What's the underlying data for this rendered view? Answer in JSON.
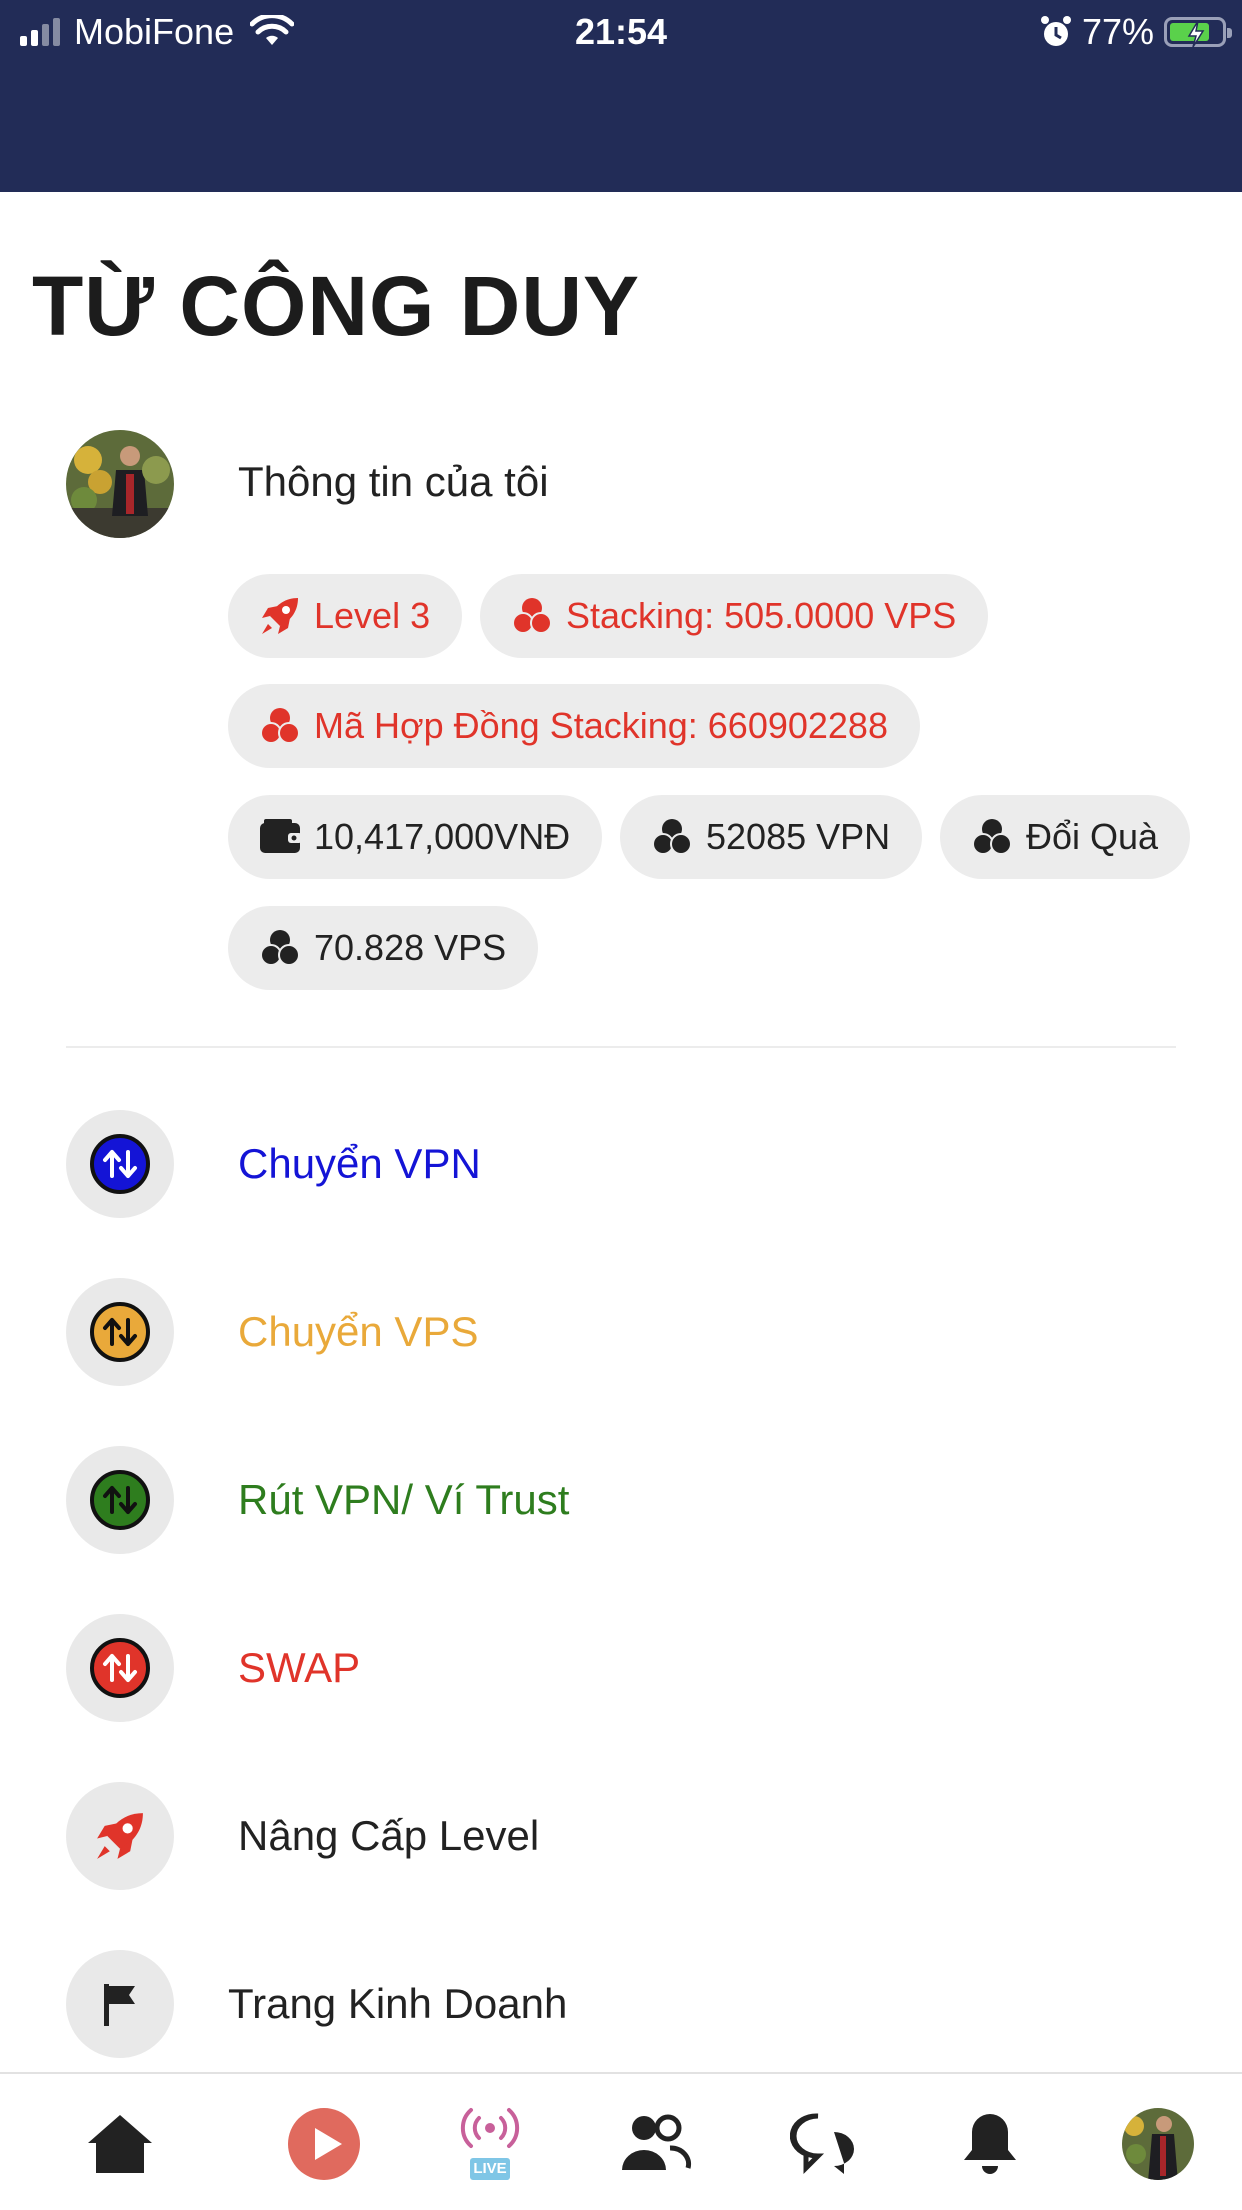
{
  "status_bar": {
    "carrier": "MobiFone",
    "time": "21:54",
    "battery": "77%"
  },
  "profile": {
    "name": "TỪ CÔNG DUY",
    "my_info_label": "Thông tin của tôi"
  },
  "badges": {
    "level": "Level 3",
    "stacking": "Stacking: 505.0000 VPS",
    "contract": "Mã Hợp Đồng Stacking: 660902288",
    "wallet": "10,417,000VNĐ",
    "vpn": "52085 VPN",
    "gift": "Đổi Quà",
    "vps": "70.828 VPS"
  },
  "menu": {
    "items": [
      {
        "label": "Chuyển VPN",
        "color": "#1414d6"
      },
      {
        "label": "Chuyển VPS",
        "color": "#e9a93a"
      },
      {
        "label": "Rút VPN/ Ví Trust",
        "color": "#2e7d1e"
      },
      {
        "label": "SWAP",
        "color": "#e0342a"
      },
      {
        "label": "Nâng Cấp Level",
        "color": "#222222"
      },
      {
        "label": "Trang Kinh Doanh",
        "color": "#222222"
      }
    ]
  },
  "bottom_nav": {
    "live_label": "LIVE"
  },
  "colors": {
    "header_bg": "#222c57",
    "chip_bg": "#ececec",
    "accent_red": "#e0342a"
  }
}
